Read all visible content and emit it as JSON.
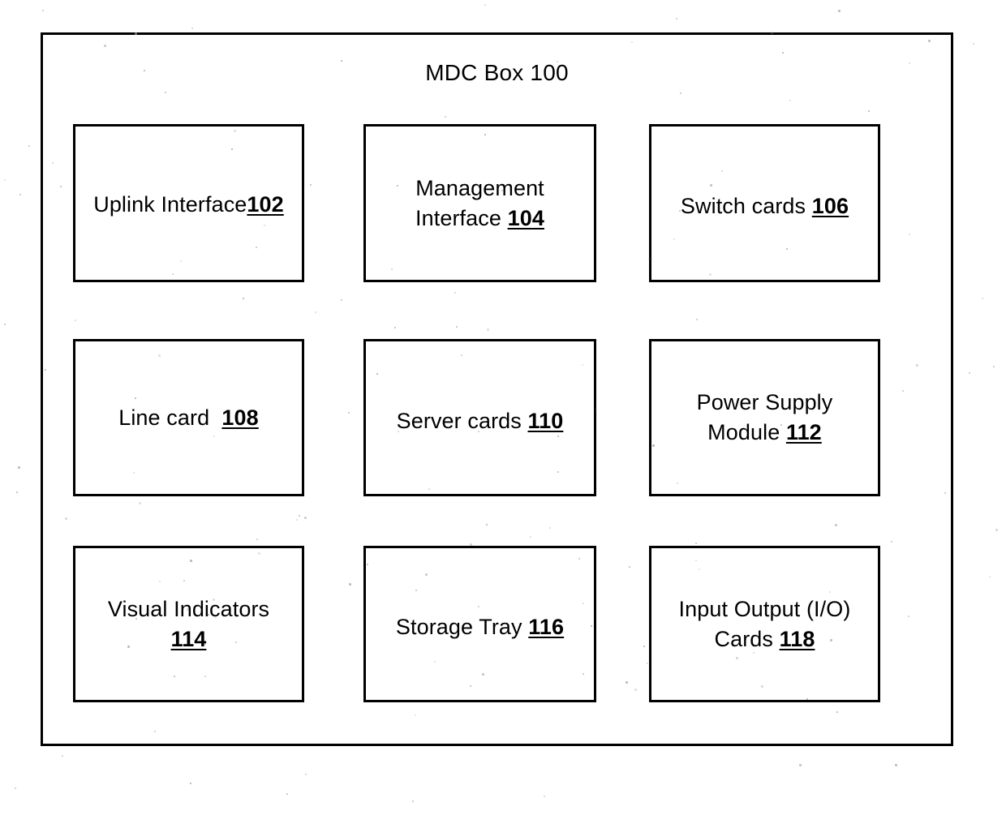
{
  "figure": {
    "title": "MDC Box 100",
    "title_text": "MDC Box",
    "title_ref": "100",
    "background_color": "#ffffff",
    "line_color": "#000000"
  },
  "components": [
    {
      "id": "uplink-interface",
      "name": "Uplink Interface",
      "ref": "102",
      "lines": [
        "Uplink Interface"
      ],
      "label": "Uplink Interface",
      "full_label": "Uplink Interface102"
    },
    {
      "id": "management-interface",
      "name": "Management Interface",
      "ref": "104",
      "line1": "Management",
      "line2": "Interface ",
      "label": "Management Interface",
      "full_label": "Management Interface 104"
    },
    {
      "id": "switch-cards",
      "name": "Switch cards",
      "ref": "106",
      "label": "Switch cards ",
      "full_label": "Switch cards 106"
    },
    {
      "id": "line-card",
      "name": "Line card",
      "ref": "108",
      "label": "Line card  ",
      "full_label": "Line card  108"
    },
    {
      "id": "server-cards",
      "name": "Server cards",
      "ref": "110",
      "label": "Server cards ",
      "full_label": "Server cards 110"
    },
    {
      "id": "power-supply-module",
      "name": "Power Supply Module",
      "ref": "112",
      "line1": "Power Supply",
      "line2": "Module ",
      "label": "Power Supply Module",
      "full_label": "Power Supply Module 112"
    },
    {
      "id": "visual-indicators",
      "name": "Visual Indicators",
      "ref": "114",
      "line1": "Visual Indicators",
      "line2": "",
      "label": "Visual Indicators",
      "full_label": "Visual Indicators 114"
    },
    {
      "id": "storage-tray",
      "name": "Storage Tray",
      "ref": "116",
      "label": "Storage Tray ",
      "full_label": "Storage Tray 116"
    },
    {
      "id": "io-cards",
      "name": "Input Output (I/O) Cards",
      "ref": "118",
      "line1": "Input Output (I/O)",
      "line2": "Cards ",
      "label": "Input Output (I/O) Cards",
      "full_label": "Input Output (I/O) Cards 118"
    }
  ],
  "labels": {
    "uplink_interface_text": "Uplink Interface",
    "uplink_interface_ref": "102",
    "management_interface_l1": "Management",
    "management_interface_l2": "Interface ",
    "management_interface_ref": "104",
    "switch_cards_text": "Switch cards ",
    "switch_cards_ref": "106",
    "line_card_text": "Line card  ",
    "line_card_ref": "108",
    "server_cards_text": "Server cards ",
    "server_cards_ref": "110",
    "power_supply_l1": "Power Supply",
    "power_supply_l2": "Module ",
    "power_supply_ref": "112",
    "visual_indicators_l1": "Visual Indicators",
    "visual_indicators_ref": "114",
    "storage_tray_text": "Storage Tray ",
    "storage_tray_ref": "116",
    "io_cards_l1": "Input Output (I/O)",
    "io_cards_l2": "Cards ",
    "io_cards_ref": "118"
  }
}
